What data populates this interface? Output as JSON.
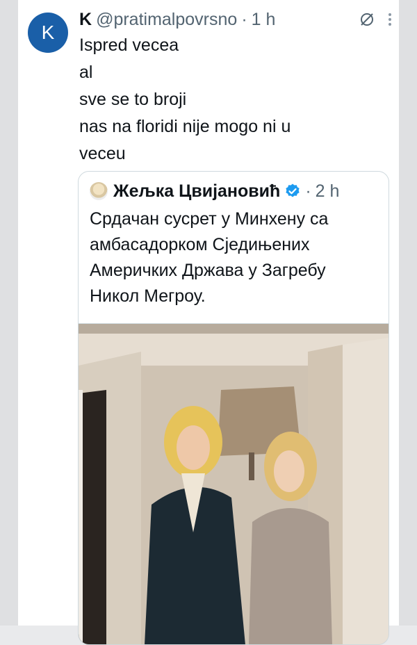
{
  "tweet": {
    "avatar_initial": "K",
    "name": "K",
    "handle": "@pratimalpovrsno",
    "separator": "·",
    "time": "1 h",
    "lines": [
      "Ispred vecea",
      "al",
      "sve se to broji",
      "nas na floridi nije mogo ni u",
      "veceu"
    ]
  },
  "quoted": {
    "name": "Жељка Цвијановић",
    "separator": "·",
    "time": "2 h",
    "lines": [
      "Срдачан сусрет у Минхену са",
      "амбасадорком Сједињених",
      "Америчких Држава у Загребу",
      "Никол Мегроу."
    ]
  },
  "icons": {
    "grok": "grok-icon",
    "more": "more-vertical-icon",
    "verified": "verified-badge-icon"
  },
  "colors": {
    "avatar": "#1a5fa8",
    "verified": "#1d9bf0",
    "muted": "#536471"
  }
}
